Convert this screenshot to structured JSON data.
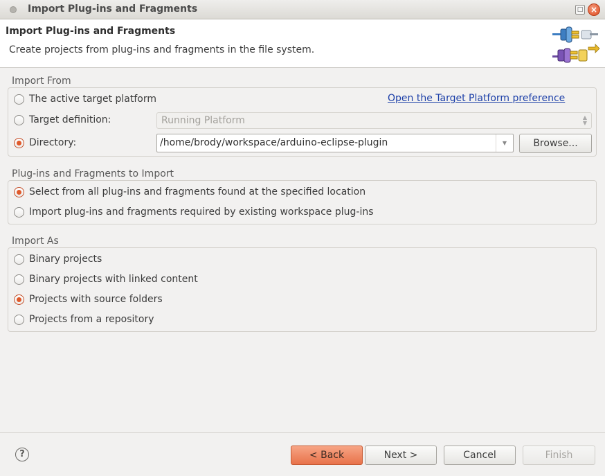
{
  "window": {
    "title": "Import Plug-ins and Fragments"
  },
  "header": {
    "title": "Import Plug-ins and Fragments",
    "description": "Create projects from plug-ins and fragments in the file system."
  },
  "import_from": {
    "label": "Import From",
    "active_target": {
      "label": "The active target platform",
      "checked": false
    },
    "target_definition": {
      "label": "Target definition:",
      "checked": false,
      "value": "Running Platform"
    },
    "directory": {
      "label": "Directory:",
      "checked": true,
      "value": "/home/brody/workspace/arduino-eclipse-plugin"
    },
    "preference_link": "Open the Target Platform preference",
    "browse_label": "Browse..."
  },
  "to_import": {
    "label": "Plug-ins and Fragments to Import",
    "options": [
      {
        "label": "Select from all plug-ins and fragments found at the specified location",
        "checked": true
      },
      {
        "label": "Import plug-ins and fragments required by existing workspace plug-ins",
        "checked": false
      }
    ]
  },
  "import_as": {
    "label": "Import As",
    "options": [
      {
        "label": "Binary projects",
        "checked": false
      },
      {
        "label": "Binary projects with linked content",
        "checked": false
      },
      {
        "label": "Projects with source folders",
        "checked": true
      },
      {
        "label": "Projects from a repository",
        "checked": false
      }
    ]
  },
  "footer": {
    "back": "< Back",
    "next": "Next >",
    "cancel": "Cancel",
    "finish": "Finish"
  },
  "colors": {
    "accent": "#e8724a",
    "link": "#1c3fa8"
  }
}
